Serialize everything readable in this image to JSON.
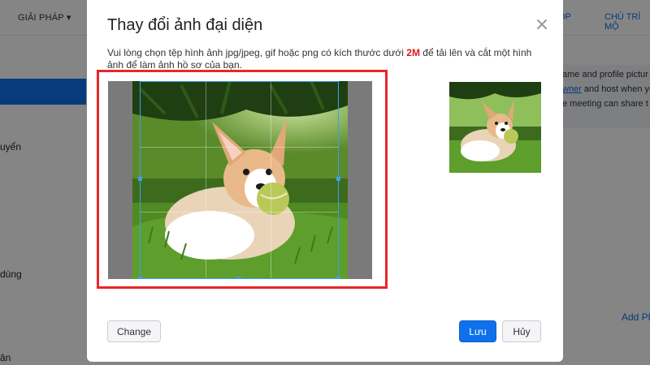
{
  "background": {
    "nav": {
      "solutions": "GIẢI PHÁP ▾",
      "right_item_1": "C HỌP",
      "right_item_2": "CHỦ TRÌ MỘ"
    },
    "sidebar": {
      "item_1": "uyển",
      "item_2": "dùng",
      "item_3": "ân"
    },
    "right_panel": {
      "line_1": "ame and profile pictur",
      "line_2_link": "wner",
      "line_2_rest": " and host when yo",
      "line_3": "e meeting can share t"
    },
    "add_link": "Add Ph"
  },
  "dialog": {
    "title": "Thay đổi ảnh đại diện",
    "description_before": "Vui lòng chọn tệp hình ảnh jpg/jpeg, gif hoặc png có kích thước dưới ",
    "description_size": "2M",
    "description_after": " để tải lên và cắt một hình ảnh để làm ảnh hồ sơ của bạn.",
    "change_button": "Change",
    "save_button": "Lưu",
    "cancel_button": "Hủy"
  },
  "colors": {
    "accent": "#0e71eb",
    "highlight_border": "#e8262a",
    "size_text": "#d91a1a"
  }
}
